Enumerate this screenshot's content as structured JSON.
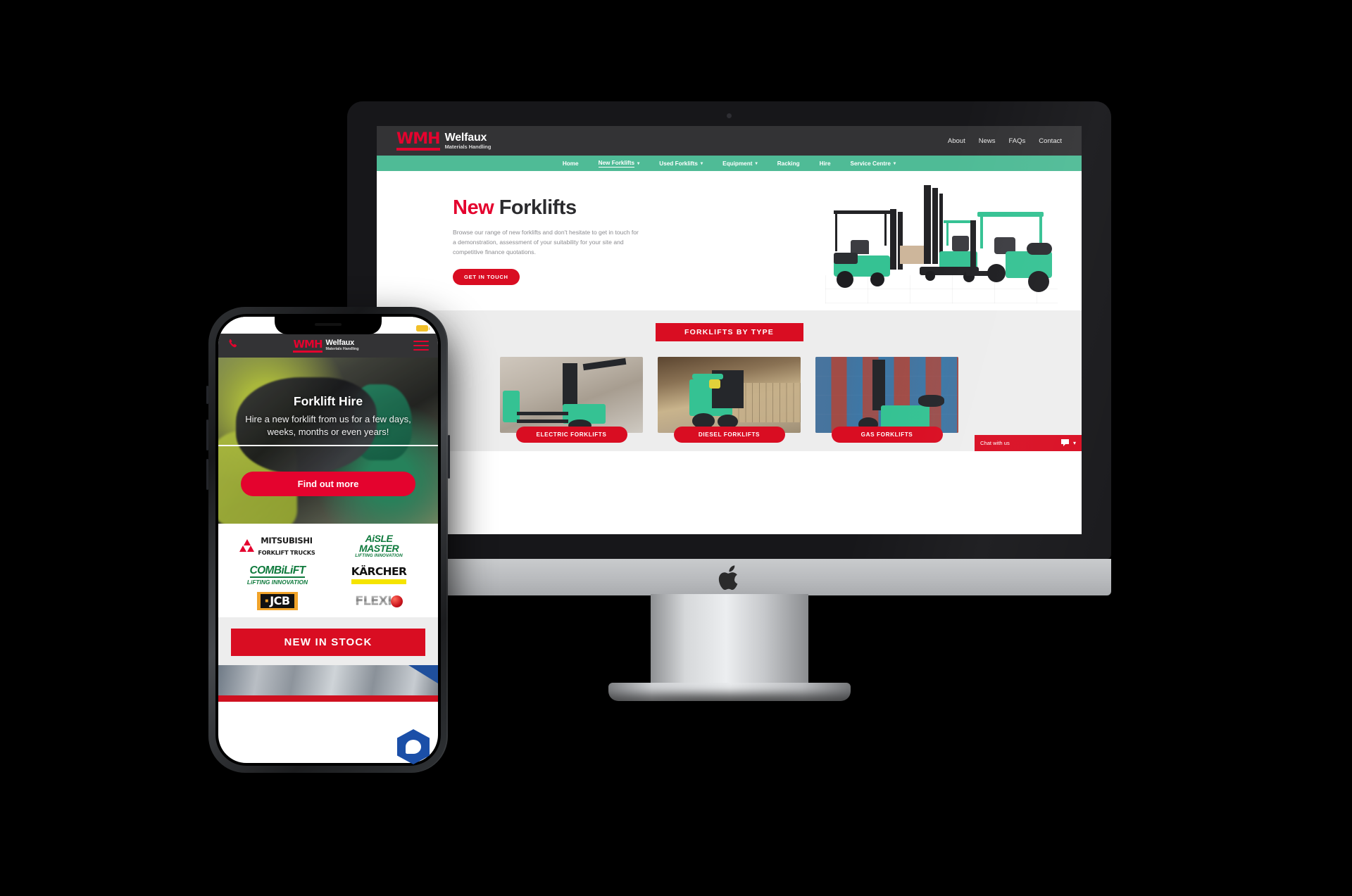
{
  "scene": {
    "description": "Responsive website mockup shown on an Apple iMac desktop and an iPhone",
    "background_color": "#000000"
  },
  "brand": {
    "mark": "WMH",
    "name_line_1": "Welfaux",
    "name_line_2": "Materials Handling",
    "accent_red": "#e4032e",
    "accent_green": "#4fbb96",
    "button_red": "#d90d22",
    "dark_bar": "#333335"
  },
  "desktop": {
    "device": "imac",
    "apple_logo": "apple-logo",
    "top_links": [
      {
        "label": "About"
      },
      {
        "label": "News"
      },
      {
        "label": "FAQs"
      },
      {
        "label": "Contact"
      }
    ],
    "nav": [
      {
        "label": "Home",
        "has_dropdown": false,
        "active": false
      },
      {
        "label": "New Forklifts",
        "has_dropdown": true,
        "active": true
      },
      {
        "label": "Used Forklifts",
        "has_dropdown": true,
        "active": false
      },
      {
        "label": "Equipment",
        "has_dropdown": true,
        "active": false
      },
      {
        "label": "Racking",
        "has_dropdown": false,
        "active": false
      },
      {
        "label": "Hire",
        "has_dropdown": false,
        "active": false
      },
      {
        "label": "Service Centre",
        "has_dropdown": true,
        "active": false
      }
    ],
    "hero": {
      "title_accent": "New",
      "title_rest": " Forklifts",
      "paragraph": "Browse our range of new forklifts and don't hesitate to get in touch for a demonstration, assessment of your suitability for your site and competitive finance quotations.",
      "cta": "GET IN TOUCH",
      "image_alt": "three-green-forklifts"
    },
    "types_section": {
      "badge": "FORKLIFTS BY TYPE",
      "cards": [
        {
          "button": "ELECTRIC FORKLIFTS",
          "image_alt": "warehouse-electric-forklift"
        },
        {
          "button": "DIESEL FORKLIFTS",
          "image_alt": "warehouse-diesel-forklift"
        },
        {
          "button": "GAS FORKLIFTS",
          "image_alt": "warehouse-gas-forklift"
        }
      ]
    },
    "chat_widget": {
      "label": "Chat with us",
      "chat_icon": "chat-bubble-icon",
      "chevron_icon": "chevron-down-icon"
    }
  },
  "phone": {
    "device": "iphone",
    "status_bar": {
      "signal_icon": "signal-bars-icon",
      "wifi_icon": "wifi-icon",
      "battery_icon": "battery-icon"
    },
    "header": {
      "phone_icon": "phone-icon",
      "menu_icon": "hamburger-menu-icon"
    },
    "hero": {
      "title": "Forklift Hire",
      "paragraph": "Hire a new forklift from us for a few days, weeks, months or even years!",
      "cta": "Find out more",
      "image_alt": "operator-hand-on-forklift-control"
    },
    "brands": [
      {
        "name": "MITSUBISHI",
        "sub": "FORKLIFT TRUCKS",
        "style": "mitsubishi"
      },
      {
        "name_1": "AiSLE",
        "name_2": "MASTER",
        "sub": "LIFTING INNOVATION",
        "style": "aisle-master"
      },
      {
        "name": "COMBiLiFT",
        "sub": "LiFTING INNOVATION",
        "style": "combilift"
      },
      {
        "name": "KÄRCHER",
        "style": "karcher"
      },
      {
        "name": "JCB",
        "style": "jcb"
      },
      {
        "name": "FLEXI",
        "style": "flexi"
      }
    ],
    "stock_button": "NEW IN STOCK",
    "chat_bubble_icon": "chat-bubble-hexagon-icon"
  }
}
